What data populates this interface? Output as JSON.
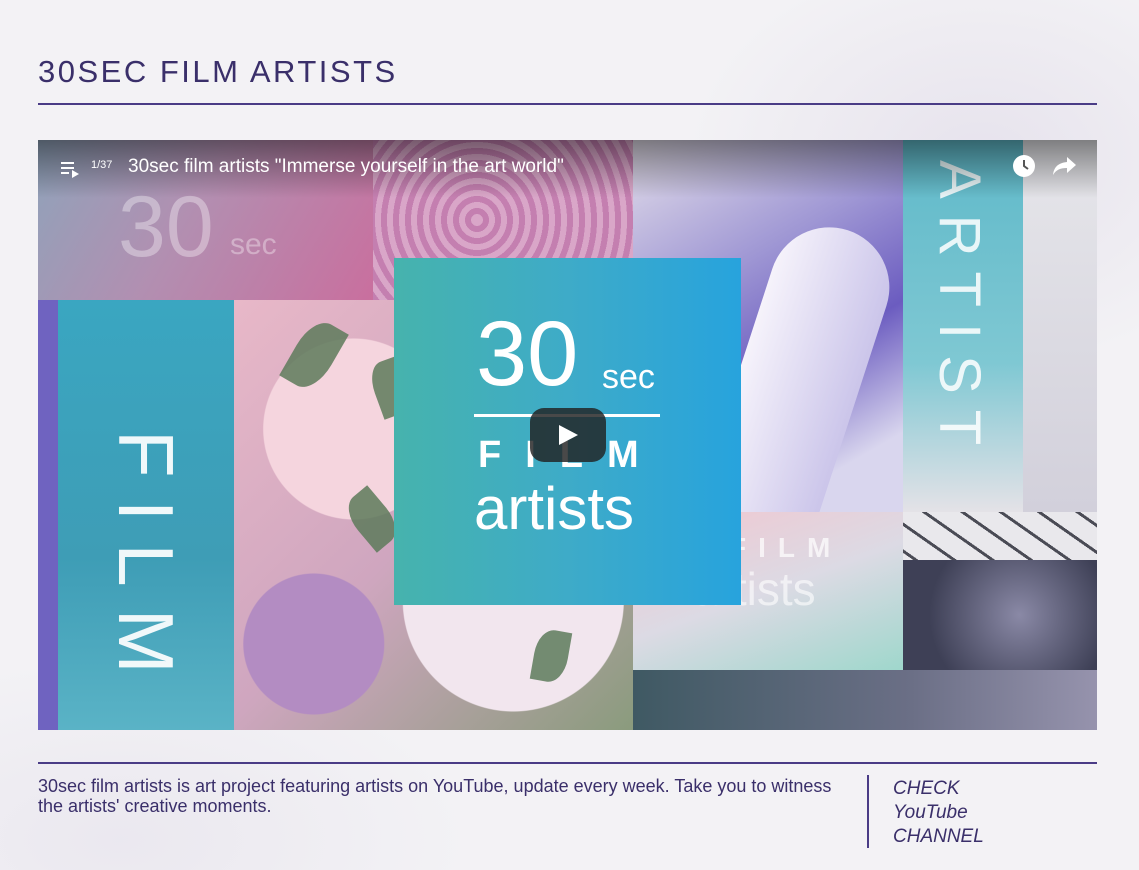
{
  "header": {
    "title": "30SEC FILM ARTISTS"
  },
  "player": {
    "playlist_position": "1/37",
    "video_title": "30sec film artists \"Immerse yourself in the art world\"",
    "thumbnail": {
      "logo_number": "30",
      "logo_unit": "sec",
      "logo_film": "FILM",
      "logo_artists": "artists",
      "tile_film_word": "FILM",
      "tile_artist_word": "ARTIST",
      "tile_small_film": "FILM",
      "tile_small_artists": "artists",
      "tile_faint_30": "30",
      "tile_faint_sec": "sec"
    },
    "icons": [
      "playlist-icon",
      "clock-icon",
      "share-icon",
      "play-icon"
    ]
  },
  "footer": {
    "description": "30sec film artists is art project featuring artists on YouTube, update every week. Take you to witness the artists' creative moments.",
    "cta_line1": "CHECK",
    "cta_line2": "YouTube",
    "cta_line3": "CHANNEL"
  },
  "colors": {
    "accent": "#3a2f6a",
    "logo_teal": "#46b3ad",
    "logo_blue": "#27a3dd",
    "background": "#f3f2f5"
  }
}
